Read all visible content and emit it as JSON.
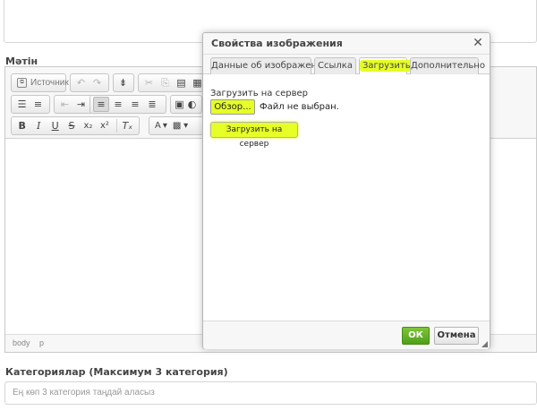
{
  "page": {
    "matin_label": "Мәтін",
    "categories_label": "Категориялар (Максимум 3 категория)",
    "categories_placeholder": "Ең көп 3 категория таңдай аласыз"
  },
  "editor": {
    "source_label": "Источник",
    "status_path": [
      "body",
      "p"
    ]
  },
  "dialog": {
    "title": "Свойства изображения",
    "close_glyph": "✕",
    "tabs": [
      {
        "label": "Данные об изображении",
        "active": false
      },
      {
        "label": "Ссылка",
        "active": false
      },
      {
        "label": "Загрузить",
        "active": true
      },
      {
        "label": "Дополнительно",
        "active": false
      }
    ],
    "upload_label": "Загрузить на сервер",
    "browse_label": "Обзор...",
    "no_file_text": "Файл не выбран.",
    "send_button_label": "Загрузить на сервер",
    "ok_label": "ОК",
    "cancel_label": "Отмена"
  },
  "colors": {
    "highlight": "#e6ff26",
    "ok_green": "#5aad1f"
  }
}
